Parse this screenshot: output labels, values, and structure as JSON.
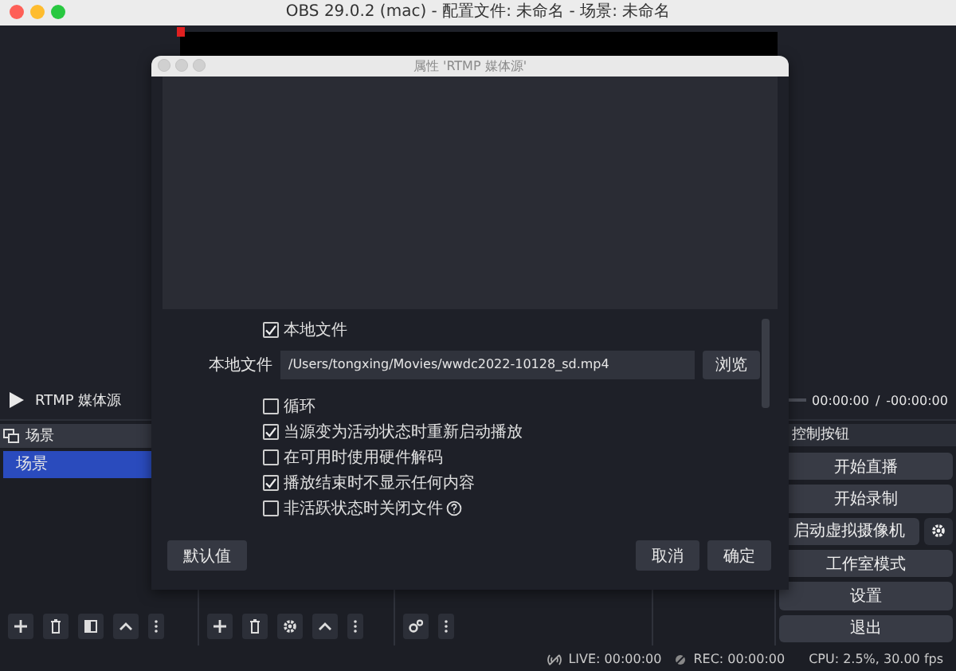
{
  "window": {
    "title": "OBS 29.0.2 (mac) - 配置文件: 未命名 - 场景: 未命名"
  },
  "media_bar": {
    "source": "RTMP 媒体源",
    "time": "00:00:00",
    "separator": "/",
    "remaining": "-00:00:00"
  },
  "scenes": {
    "title": "场景",
    "items": [
      {
        "label": "场景",
        "selected": true
      }
    ]
  },
  "controls": {
    "title": "控制按钮",
    "buttons": [
      {
        "label": "开始直播",
        "kind": "plain"
      },
      {
        "label": "开始录制",
        "kind": "plain"
      },
      {
        "label": "启动虚拟摄像机",
        "kind": "with-settings"
      },
      {
        "label": "工作室模式",
        "kind": "plain"
      },
      {
        "label": "设置",
        "kind": "plain"
      },
      {
        "label": "退出",
        "kind": "plain"
      }
    ]
  },
  "status_bar": {
    "live": "LIVE: 00:00:00",
    "rec": "REC: 00:00:00",
    "cpu": "CPU: 2.5%, 30.00 fps"
  },
  "dialog": {
    "title": "属性 'RTMP 媒体源'",
    "properties": [
      {
        "kind": "checkbox",
        "label": "本地文件",
        "checked": true
      },
      {
        "kind": "file",
        "label": "本地文件",
        "value": "/Users/tongxing/Movies/wwdc2022-10128_sd.mp4",
        "button": "浏览"
      },
      {
        "kind": "checkbox",
        "label": "循环",
        "checked": false
      },
      {
        "kind": "checkbox",
        "label": "当源变为活动状态时重新启动播放",
        "checked": true
      },
      {
        "kind": "checkbox",
        "label": "在可用时使用硬件解码",
        "checked": false
      },
      {
        "kind": "checkbox",
        "label": "播放结束时不显示任何内容",
        "checked": true
      },
      {
        "kind": "checkbox",
        "label": "非活跃状态时关闭文件",
        "checked": false,
        "help": true
      }
    ],
    "buttons": {
      "defaults": "默认值",
      "cancel": "取消",
      "ok": "确定"
    }
  }
}
